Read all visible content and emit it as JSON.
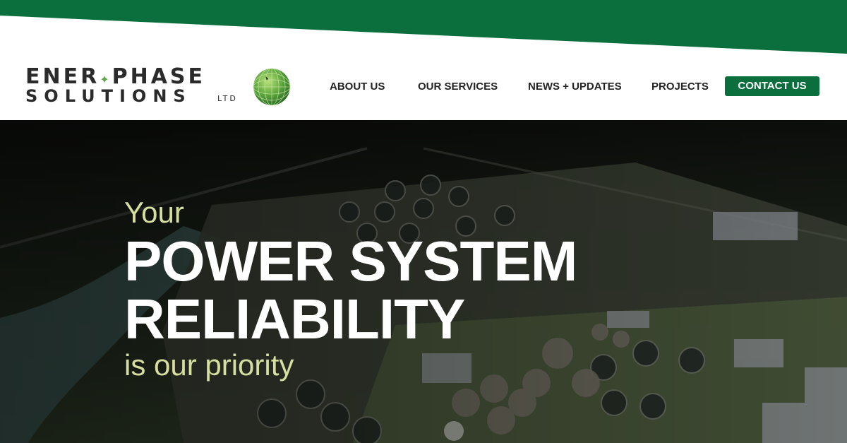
{
  "colors": {
    "brand_green": "#0a6f3c",
    "headline_accent": "#d6dea0",
    "headline_white": "#ffffff"
  },
  "logo": {
    "line1": "ENER",
    "line1b": "PHASE",
    "line2": "SOLUTIONS",
    "suffix": "LTD",
    "icon": "green-globe-icon"
  },
  "nav": {
    "items": [
      "ABOUT US",
      "OUR SERVICES",
      "NEWS + UPDATES",
      "PROJECTS"
    ],
    "cta": "CONTACT US"
  },
  "hero": {
    "line1": "Your",
    "line2": "POWER SYSTEM",
    "line3": "RELIABILITY",
    "line4": "is our priority"
  }
}
